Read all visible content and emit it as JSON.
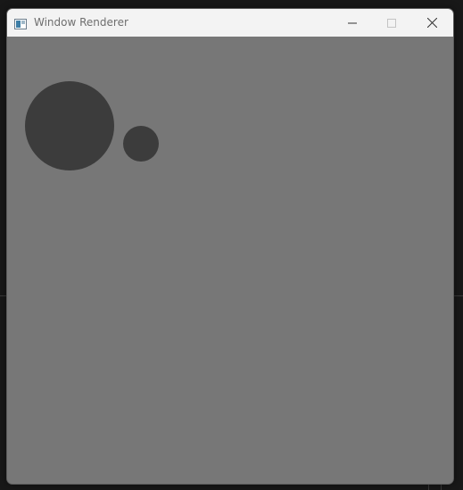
{
  "window": {
    "title": "Window Renderer",
    "app_icon": "window-app-icon",
    "controls": {
      "minimize_icon": "minimize-icon",
      "maximize_icon": "maximize-icon",
      "close_icon": "close-icon"
    }
  },
  "canvas": {
    "background_color": "#777777",
    "shape_color": "#3c3c3c",
    "shapes": [
      "large-circle",
      "small-circle"
    ]
  }
}
